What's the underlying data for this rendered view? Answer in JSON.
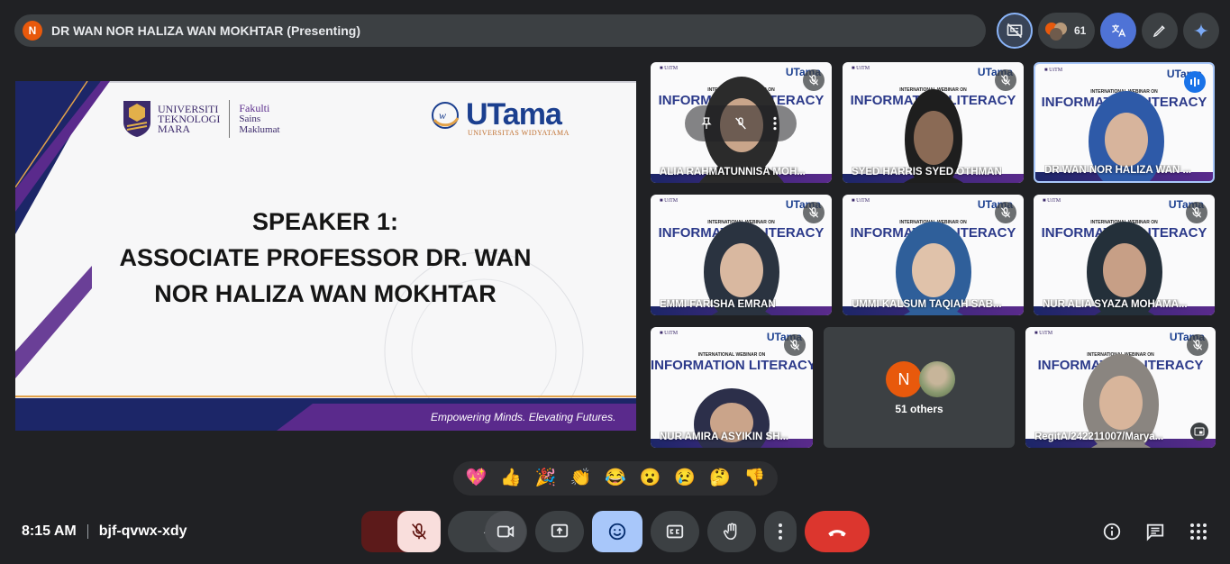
{
  "header": {
    "presenter_initial": "N",
    "presenter_label": "DR WAN NOR HALIZA WAN MOKHTAR (Presenting)",
    "participant_count": "61"
  },
  "slide": {
    "uitm_lines": [
      "UNIVERSITI",
      "TEKNOLOGI",
      "MARA"
    ],
    "fakulti_lines": [
      "Fakulti",
      "Sains",
      "Maklumat"
    ],
    "utama_title": "UTama",
    "utama_sub": "UNIVERSITAS WIDYATAMA",
    "speaker_lines": [
      "SPEAKER 1:",
      "ASSOCIATE PROFESSOR DR. WAN",
      "NOR HALIZA WAN MOKHTAR"
    ],
    "tagline": "Empowering Minds. Elevating Futures."
  },
  "tiles": [
    {
      "name": "ALIA RAHMATUNNISA MOH...",
      "muted": true,
      "banner_heading": "INFORMATION LITERACY",
      "banner_small": "INTERNATIONAL WEBINAR ON"
    },
    {
      "name": "SYED HARRIS SYED OTHMAN",
      "muted": true,
      "banner_heading": "INFORMATION LITERACY",
      "banner_small": "INTERNATIONAL WEBINAR ON"
    },
    {
      "name": "DR WAN NOR HALIZA WAN ...",
      "muted": false,
      "speaking": true,
      "banner_heading": "INFORMATION LITERACY",
      "banner_small": "INTERNATIONAL WEBINAR ON"
    },
    {
      "name": "EMMI FARISHA EMRAN",
      "muted": true,
      "banner_heading": "INFORMATION LITERACY",
      "banner_small": "INTERNATIONAL WEBINAR ON"
    },
    {
      "name": "UMMI KALSUM TAQIAH SAB...",
      "muted": true,
      "banner_heading": "INFORMATION LITERACY",
      "banner_small": "INTERNATIONAL WEBINAR ON"
    },
    {
      "name": "NUR ALIA SYAZA MOHAMA...",
      "muted": true,
      "banner_heading": "INFORMATION LITERACY",
      "banner_small": "INTERNATIONAL WEBINAR ON"
    },
    {
      "name": "NUR AMIRA ASYIKIN SH...",
      "muted": true,
      "banner_heading": "INFORMATION LITERACY",
      "banner_small": "INTERNATIONAL WEBINAR ON"
    },
    {
      "name": "RegitA/242211007/Marya...",
      "muted": true,
      "banner_heading": "INFORMATION LITERACY",
      "banner_small": "INTERNATIONAL WEBINAR ON"
    }
  ],
  "others": {
    "initial": "N",
    "label": "51 others"
  },
  "reactions": [
    "💖",
    "👍",
    "🎉",
    "👏",
    "😂",
    "😮",
    "😢",
    "🤔",
    "👎"
  ],
  "meeting": {
    "time": "8:15 AM",
    "code": "bjf-qvwx-xdy"
  },
  "colors": {
    "accent": "#a8c7fa",
    "hangup": "#dc362e",
    "mic_off_bg": "#f9dedc",
    "presenter_avatar": "#e8590c"
  },
  "icons": [
    "hide-presentation-icon",
    "people-icon",
    "translate-icon",
    "pen-icon",
    "gemini-icon",
    "mic-off-icon",
    "camera-icon",
    "present-icon",
    "emoji-icon",
    "captions-icon",
    "hand-icon",
    "more-icon",
    "hangup-icon",
    "info-icon",
    "chat-icon",
    "apps-icon"
  ]
}
